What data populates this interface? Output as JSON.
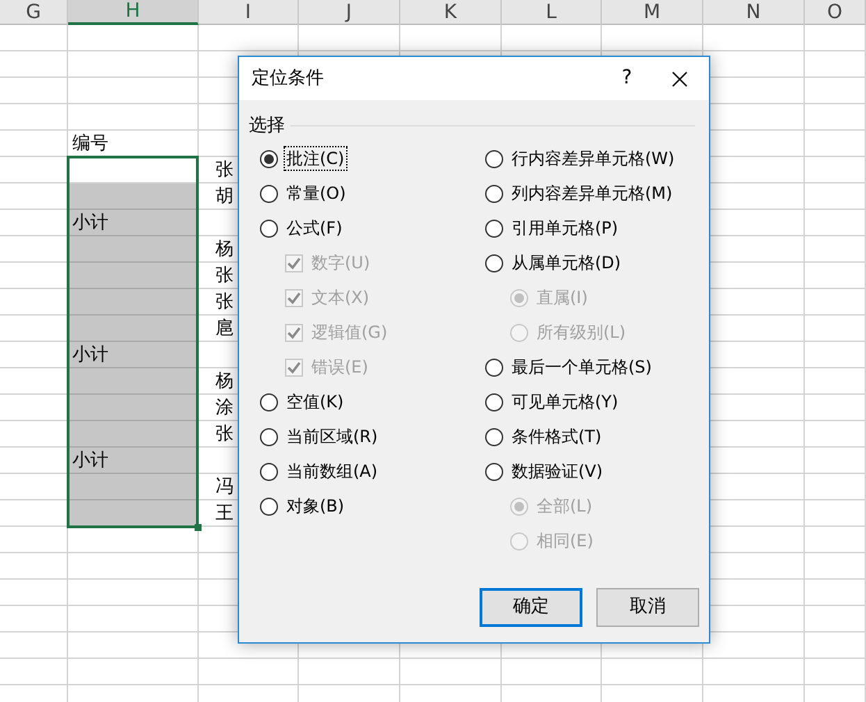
{
  "sheet": {
    "columns": [
      {
        "label": "G",
        "selected": false
      },
      {
        "label": "H",
        "selected": true
      },
      {
        "label": "I",
        "selected": false
      },
      {
        "label": "J",
        "selected": false
      },
      {
        "label": "K",
        "selected": false
      },
      {
        "label": "L",
        "selected": false
      },
      {
        "label": "M",
        "selected": false
      },
      {
        "label": "N",
        "selected": false
      },
      {
        "label": "O",
        "selected": false
      }
    ],
    "rows": [
      {
        "h": "编号",
        "selected": false,
        "active": false
      },
      {
        "i": "张",
        "selected": true,
        "active": true
      },
      {
        "i": "胡",
        "selected": true,
        "active": false
      },
      {
        "h": "小计",
        "selected": true,
        "active": false
      },
      {
        "i": "杨",
        "selected": true,
        "active": false
      },
      {
        "i": "张",
        "selected": true,
        "active": false
      },
      {
        "i": "张",
        "selected": true,
        "active": false
      },
      {
        "i": "扈",
        "selected": true,
        "active": false
      },
      {
        "h": "小计",
        "selected": true,
        "active": false
      },
      {
        "i": "杨",
        "selected": true,
        "active": false
      },
      {
        "i": "涂",
        "selected": true,
        "active": false
      },
      {
        "i": "张",
        "selected": true,
        "active": false
      },
      {
        "h": "小计",
        "selected": true,
        "active": false
      },
      {
        "i": "冯",
        "selected": true,
        "active": false
      },
      {
        "i": "王",
        "selected": true,
        "active": false
      }
    ]
  },
  "dialog": {
    "title": "定位条件",
    "help": "?",
    "group_label": "选择",
    "left_options": [
      {
        "kind": "radio",
        "label": "批注(C)",
        "selected": true,
        "disabled": false,
        "focused": true
      },
      {
        "kind": "radio",
        "label": "常量(O)",
        "selected": false,
        "disabled": false,
        "focused": false
      },
      {
        "kind": "radio",
        "label": "公式(F)",
        "selected": false,
        "disabled": false,
        "focused": false,
        "children": [
          {
            "kind": "checkbox",
            "label": "数字(U)",
            "checked": true,
            "disabled": true,
            "focused": false
          },
          {
            "kind": "checkbox",
            "label": "文本(X)",
            "checked": true,
            "disabled": true,
            "focused": false
          },
          {
            "kind": "checkbox",
            "label": "逻辑值(G)",
            "checked": true,
            "disabled": true,
            "focused": false
          },
          {
            "kind": "checkbox",
            "label": "错误(E)",
            "checked": true,
            "disabled": true,
            "focused": false
          }
        ]
      },
      {
        "kind": "radio",
        "label": "空值(K)",
        "selected": false,
        "disabled": false,
        "focused": false
      },
      {
        "kind": "radio",
        "label": "当前区域(R)",
        "selected": false,
        "disabled": false,
        "focused": false
      },
      {
        "kind": "radio",
        "label": "当前数组(A)",
        "selected": false,
        "disabled": false,
        "focused": false
      },
      {
        "kind": "radio",
        "label": "对象(B)",
        "selected": false,
        "disabled": false,
        "focused": false
      }
    ],
    "right_options": [
      {
        "kind": "radio",
        "label": "行内容差异单元格(W)",
        "selected": false,
        "disabled": false,
        "focused": false
      },
      {
        "kind": "radio",
        "label": "列内容差异单元格(M)",
        "selected": false,
        "disabled": false,
        "focused": false
      },
      {
        "kind": "radio",
        "label": "引用单元格(P)",
        "selected": false,
        "disabled": false,
        "focused": false
      },
      {
        "kind": "radio",
        "label": "从属单元格(D)",
        "selected": false,
        "disabled": false,
        "focused": false,
        "children": [
          {
            "kind": "radio",
            "label": "直属(I)",
            "selected": true,
            "disabled": true,
            "focused": false
          },
          {
            "kind": "radio",
            "label": "所有级别(L)",
            "selected": false,
            "disabled": true,
            "focused": false
          }
        ]
      },
      {
        "kind": "radio",
        "label": "最后一个单元格(S)",
        "selected": false,
        "disabled": false,
        "focused": false
      },
      {
        "kind": "radio",
        "label": "可见单元格(Y)",
        "selected": false,
        "disabled": false,
        "focused": false
      },
      {
        "kind": "radio",
        "label": "条件格式(T)",
        "selected": false,
        "disabled": false,
        "focused": false
      },
      {
        "kind": "radio",
        "label": "数据验证(V)",
        "selected": false,
        "disabled": false,
        "focused": false,
        "children": [
          {
            "kind": "radio",
            "label": "全部(L)",
            "selected": true,
            "disabled": true,
            "focused": false
          },
          {
            "kind": "radio",
            "label": "相同(E)",
            "selected": false,
            "disabled": true,
            "focused": false
          }
        ]
      }
    ],
    "buttons": [
      {
        "label": "确定",
        "default": true
      },
      {
        "label": "取消",
        "default": false
      }
    ]
  }
}
